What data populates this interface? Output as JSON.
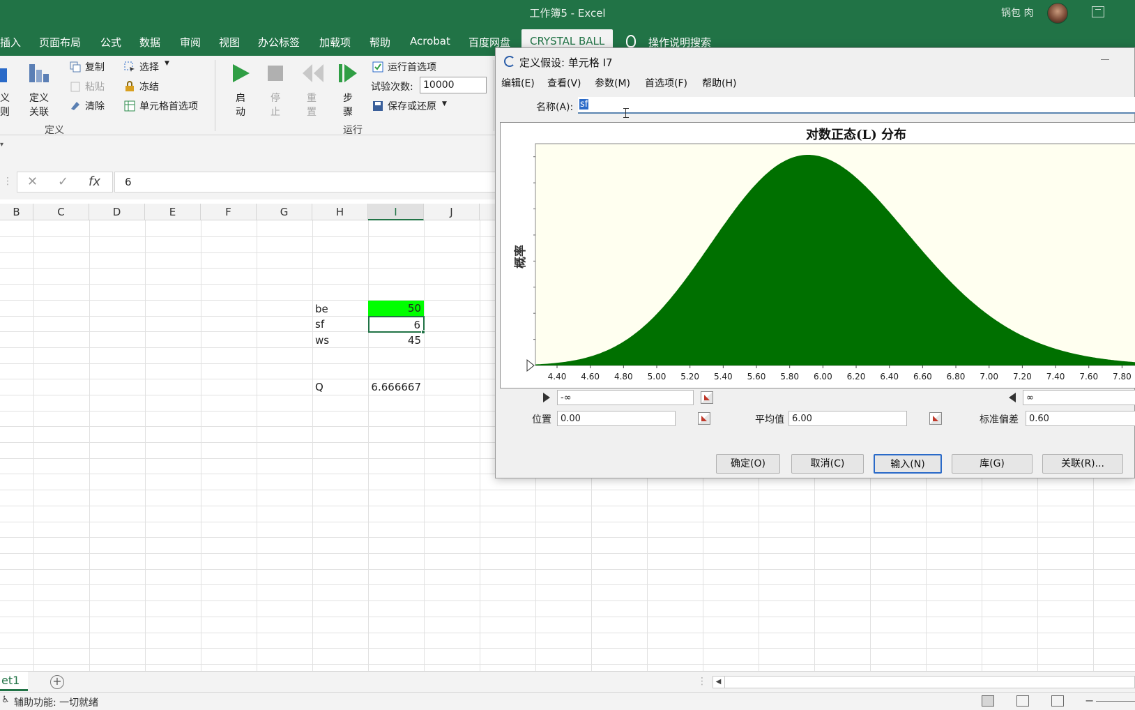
{
  "window": {
    "title": "工作簿5  -  Excel",
    "user_name": "锅包 肉"
  },
  "tabs": [
    "插入",
    "页面布局",
    "公式",
    "数据",
    "审阅",
    "视图",
    "办公标签",
    "加载项",
    "帮助",
    "Acrobat",
    "百度网盘",
    "CRYSTAL BALL"
  ],
  "search_label": "操作说明搜索",
  "ribbon": {
    "define_group": {
      "partial_label_1": "义",
      "partial_label_2": "则",
      "define_link_line1": "定义",
      "define_link_line2": "关联",
      "copy": "复制",
      "paste": "粘贴",
      "clear": "清除",
      "select": "选择",
      "freeze": "冻结",
      "cell_prefs": "单元格首选项",
      "group_label": "定义"
    },
    "run_group": {
      "start_1": "启",
      "start_2": "动",
      "stop_1": "停",
      "stop_2": "止",
      "reset_1": "重",
      "reset_2": "置",
      "step_1": "步",
      "step_2": "骤",
      "run_prefs": "运行首选项",
      "trials_label": "试验次数:",
      "trials_value": "10000",
      "save_restore": "保存或还原",
      "group_label": "运行"
    }
  },
  "formula_bar": {
    "value": "6"
  },
  "grid": {
    "columns": [
      "B",
      "C",
      "D",
      "E",
      "F",
      "G",
      "H",
      "I",
      "J"
    ],
    "selected_column": "I",
    "cells": [
      {
        "label": "be",
        "value": "50"
      },
      {
        "label": "sf",
        "value": "6"
      },
      {
        "label": "ws",
        "value": "45"
      },
      {
        "label": "Q",
        "value": "6.666667"
      }
    ]
  },
  "sheet_tab": "et1",
  "status": {
    "text": "辅助功能: 一切就绪"
  },
  "dialog": {
    "title": "定义假设: 单元格 I7",
    "menu": [
      "编辑(E)",
      "查看(V)",
      "参数(M)",
      "首选项(F)",
      "帮助(H)"
    ],
    "name_label": "名称(A):",
    "name_value": "sf",
    "lower_bound": "-∞",
    "upper_bound": "∞",
    "params": {
      "location_label": "位置",
      "location_value": "0.00",
      "mean_label": "平均值",
      "mean_value": "6.00",
      "std_label": "标准偏差",
      "std_value": "0.60"
    },
    "buttons": [
      "确定(O)",
      "取消(C)",
      "输入(N)",
      "库(G)",
      "关联(R)..."
    ]
  },
  "chart_data": {
    "type": "area",
    "title": "对数正态(L) 分布",
    "xlabel": "",
    "ylabel": "概率",
    "distribution": "lognormal",
    "location": 0.0,
    "mean": 6.0,
    "std_dev": 0.6,
    "x_ticks": [
      "4.40",
      "4.60",
      "4.80",
      "5.00",
      "5.20",
      "5.40",
      "5.60",
      "5.80",
      "6.00",
      "6.20",
      "6.40",
      "6.60",
      "6.80",
      "7.00",
      "7.20",
      "7.40",
      "7.60",
      "7.80"
    ],
    "xlim": [
      4.27,
      7.92
    ],
    "fill_color": "#007000",
    "plot_bg": "#fffff0"
  }
}
